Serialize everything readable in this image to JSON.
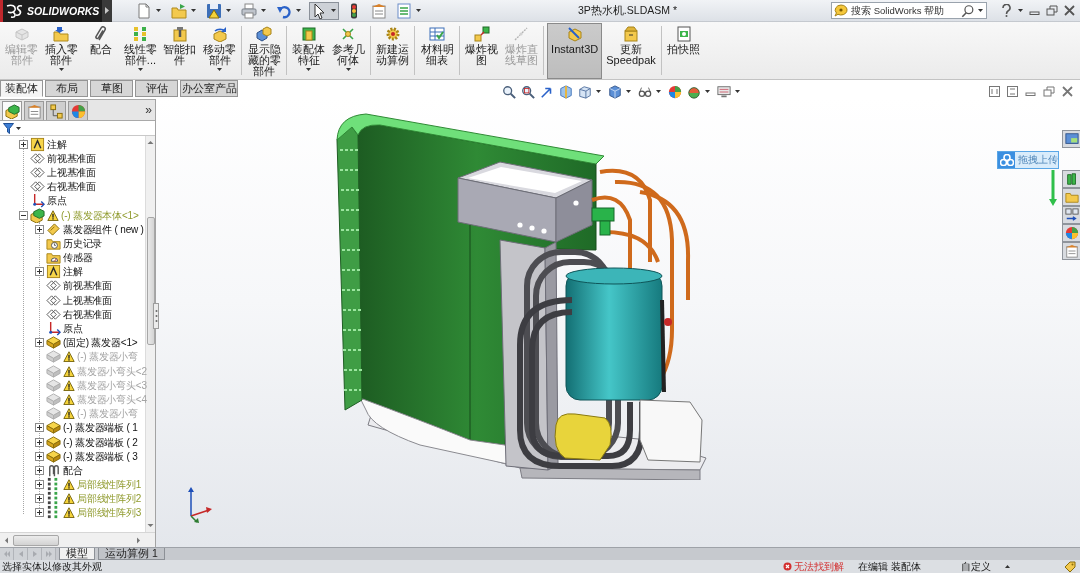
{
  "app_logo": {
    "text": "SOLIDWORKS"
  },
  "window": {
    "title": "3P热水机.SLDASM *"
  },
  "quick_access": [
    {
      "has_menu": true,
      "pressed": false
    },
    {
      "has_menu": true,
      "pressed": false
    },
    {
      "has_menu": true,
      "pressed": false
    },
    {
      "has_menu": true,
      "pressed": false
    },
    {
      "has_menu": true,
      "pressed": false
    },
    {
      "has_menu": true,
      "pressed": true
    },
    {
      "has_menu": false,
      "pressed": false
    },
    {
      "has_menu": false,
      "pressed": false
    },
    {
      "has_menu": true,
      "pressed": false
    }
  ],
  "search": {
    "placeholder": "搜索 SolidWorks 帮助"
  },
  "ribbon": {
    "groups": [
      {
        "buttons": [
          {
            "label": "编辑零部件",
            "disabled": true,
            "pressed": false,
            "has_menu": false
          },
          {
            "label": "插入零部件",
            "disabled": false,
            "pressed": false,
            "has_menu": true
          },
          {
            "label": "配合",
            "disabled": false,
            "pressed": false,
            "has_menu": false
          },
          {
            "label": "线性零部件...",
            "disabled": false,
            "pressed": false,
            "has_menu": true
          },
          {
            "label": "智能扣件",
            "disabled": false,
            "pressed": false,
            "has_menu": false
          },
          {
            "label": "移动零部件",
            "disabled": false,
            "pressed": false,
            "has_menu": true
          }
        ]
      },
      {
        "buttons": [
          {
            "label": "显示隐藏的零部件",
            "disabled": false,
            "pressed": false,
            "has_menu": false
          }
        ]
      },
      {
        "buttons": [
          {
            "label": "装配体特征",
            "disabled": false,
            "pressed": false,
            "has_menu": true
          },
          {
            "label": "参考几何体",
            "disabled": false,
            "pressed": false,
            "has_menu": true
          }
        ]
      },
      {
        "buttons": [
          {
            "label": "新建运动算例",
            "disabled": false,
            "pressed": false,
            "has_menu": false
          }
        ]
      },
      {
        "buttons": [
          {
            "label": "材料明细表",
            "disabled": false,
            "pressed": false,
            "has_menu": false
          }
        ]
      },
      {
        "buttons": [
          {
            "label": "爆炸视图",
            "disabled": false,
            "pressed": false,
            "has_menu": false
          },
          {
            "label": "爆炸直线草图",
            "disabled": true,
            "pressed": false,
            "has_menu": false
          }
        ]
      },
      {
        "buttons": [
          {
            "label": "Instant3D",
            "disabled": false,
            "pressed": true,
            "has_menu": false
          },
          {
            "label": "更新Speedpak",
            "disabled": false,
            "pressed": false,
            "has_menu": false
          }
        ]
      },
      {
        "buttons": [
          {
            "label": "拍快照",
            "disabled": false,
            "pressed": false,
            "has_menu": false
          }
        ]
      }
    ]
  },
  "ribbon_tabs": [
    {
      "label": "装配体",
      "selected": true
    },
    {
      "label": "布局",
      "selected": false
    },
    {
      "label": "草图",
      "selected": false
    },
    {
      "label": "评估",
      "selected": false
    },
    {
      "label": "办公室产品",
      "selected": false
    }
  ],
  "feature_manager": {
    "tabs": [
      {
        "selected": true
      },
      {
        "selected": false
      },
      {
        "selected": false
      },
      {
        "selected": false
      }
    ],
    "more": "»",
    "tree": [
      {
        "label": "注解",
        "kind": "annotation",
        "expanded": false,
        "warning": false,
        "suppressed": false
      },
      {
        "label": "前视基准面",
        "kind": "plane",
        "warning": false,
        "suppressed": false
      },
      {
        "label": "上视基准面",
        "kind": "plane",
        "warning": false,
        "suppressed": false
      },
      {
        "label": "右视基准面",
        "kind": "plane",
        "warning": false,
        "suppressed": false
      },
      {
        "label": "原点",
        "kind": "origin",
        "warning": false,
        "suppressed": false
      },
      {
        "label": "(-) 蒸发器本体<1>",
        "kind": "assembly",
        "expanded": true,
        "warning": true,
        "suppressed": false,
        "children": [
          {
            "label": "蒸发器组件 ( new )",
            "kind": "component",
            "expanded": false,
            "warning": false,
            "suppressed": false
          },
          {
            "label": "历史记录",
            "kind": "history",
            "warning": false,
            "suppressed": false
          },
          {
            "label": "传感器",
            "kind": "sensor",
            "warning": false,
            "suppressed": false
          },
          {
            "label": "注解",
            "kind": "annotation",
            "expanded": false,
            "warning": false,
            "suppressed": false
          },
          {
            "label": "前视基准面",
            "kind": "plane",
            "warning": false,
            "suppressed": false
          },
          {
            "label": "上视基准面",
            "kind": "plane",
            "warning": false,
            "suppressed": false
          },
          {
            "label": "右视基准面",
            "kind": "plane",
            "warning": false,
            "suppressed": false
          },
          {
            "label": "原点",
            "kind": "origin",
            "warning": false,
            "suppressed": false
          },
          {
            "label": "(固定) 蒸发器<1>",
            "kind": "part",
            "expanded": false,
            "warning": false,
            "suppressed": false
          },
          {
            "label": "(-) 蒸发器小弯",
            "kind": "part",
            "warning": true,
            "suppressed": true
          },
          {
            "label": "蒸发器小弯头<2",
            "kind": "part",
            "warning": true,
            "suppressed": true
          },
          {
            "label": "蒸发器小弯头<3",
            "kind": "part",
            "warning": true,
            "suppressed": true
          },
          {
            "label": "蒸发器小弯头<4",
            "kind": "part",
            "warning": true,
            "suppressed": true
          },
          {
            "label": "(-) 蒸发器小弯",
            "kind": "part",
            "warning": true,
            "suppressed": true
          },
          {
            "label": "(-) 蒸发器端板 ( 1",
            "kind": "part",
            "expanded": false,
            "warning": false,
            "suppressed": false
          },
          {
            "label": "(-) 蒸发器端板 ( 2",
            "kind": "part",
            "expanded": false,
            "warning": false,
            "suppressed": false
          },
          {
            "label": "(-) 蒸发器端板 ( 3",
            "kind": "part",
            "expanded": false,
            "warning": false,
            "suppressed": false
          },
          {
            "label": "配合",
            "kind": "mates",
            "expanded": false,
            "warning": false,
            "suppressed": false
          },
          {
            "label": "局部线性阵列1",
            "kind": "pattern",
            "expanded": false,
            "warning": true,
            "suppressed": false
          },
          {
            "label": "局部线性阵列2",
            "kind": "pattern",
            "expanded": false,
            "warning": true,
            "suppressed": false
          },
          {
            "label": "局部线性阵列3",
            "kind": "pattern",
            "expanded": false,
            "warning": true,
            "suppressed": false
          }
        ]
      }
    ]
  },
  "tab_scroll_buttons": [
    {
      "disabled": true
    },
    {
      "disabled": true
    },
    {
      "disabled": true
    },
    {
      "disabled": true
    }
  ],
  "bottom_tabs": [
    {
      "label": "模型",
      "selected": true
    },
    {
      "label": "运动算例 1",
      "selected": false
    }
  ],
  "heads_up_toolbar": [
    {
      "has_menu": false
    },
    {
      "has_menu": false
    },
    {
      "has_menu": false
    },
    {
      "has_menu": false
    },
    {
      "has_menu": true
    },
    {
      "has_menu": true
    },
    {
      "has_menu": true
    },
    {
      "has_menu": false
    },
    {
      "has_menu": true
    },
    {
      "has_menu": true
    }
  ],
  "upload_badge": {
    "label": "拖拽上传"
  },
  "status_bar": {
    "hint": "选择实体以修改其外观",
    "error": "无法找到解",
    "mode": "在编辑 装配体",
    "units": "自定义"
  }
}
